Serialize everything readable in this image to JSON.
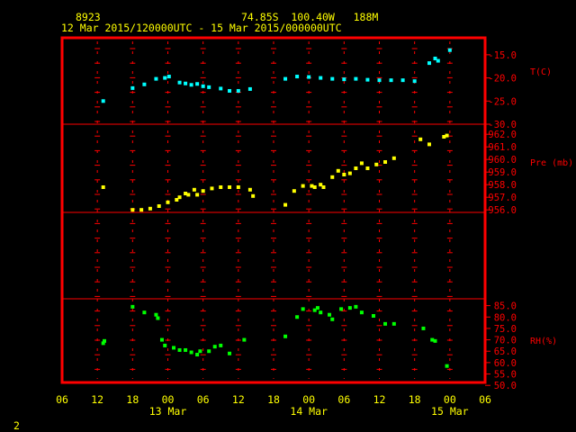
{
  "header": {
    "station": "8923",
    "location": "74.85S  100.40W   188M",
    "time_range": "12 Mar 2015/120000UTC - 15 Mar 2015/000000UTC"
  },
  "footer": {
    "page_number": "2"
  },
  "colors": {
    "frame": "#ff0000",
    "text": "#ffff00",
    "axis_text": "#ff0000",
    "temperature": "#00ffff",
    "pressure": "#ffff00",
    "humidity": "#00ff00"
  },
  "chart_data": {
    "type": "scatter",
    "x_axis": {
      "unit": "hours since 12 Mar 2015 00UTC",
      "range": [
        6,
        78
      ],
      "ticks": [
        {
          "x": 6,
          "label": "06"
        },
        {
          "x": 12,
          "label": "12"
        },
        {
          "x": 18,
          "label": "18"
        },
        {
          "x": 24,
          "label": "00"
        },
        {
          "x": 30,
          "label": "06"
        },
        {
          "x": 36,
          "label": "12"
        },
        {
          "x": 42,
          "label": "18"
        },
        {
          "x": 48,
          "label": "00"
        },
        {
          "x": 54,
          "label": "06"
        },
        {
          "x": 60,
          "label": "12"
        },
        {
          "x": 66,
          "label": "18"
        },
        {
          "x": 72,
          "label": "00"
        },
        {
          "x": 78,
          "label": "06"
        }
      ],
      "date_labels": [
        {
          "x": 24,
          "label": "13 Mar"
        },
        {
          "x": 48,
          "label": "14 Mar"
        },
        {
          "x": 72,
          "label": "15 Mar"
        }
      ]
    },
    "panels": [
      {
        "name": "temperature",
        "label": "T(C)",
        "ylim": [
          -30,
          -12.5
        ],
        "ticks": [
          {
            "v": -15,
            "label": "-15.0"
          },
          {
            "v": -20,
            "label": "-20.0"
          },
          {
            "v": -25,
            "label": "-25.0"
          },
          {
            "v": -30,
            "label": "-30.0"
          }
        ],
        "points": [
          [
            13,
            -25.0
          ],
          [
            18,
            -22.2
          ],
          [
            20,
            -21.4
          ],
          [
            22,
            -20.2
          ],
          [
            23.5,
            -20.0
          ],
          [
            24.2,
            -19.7
          ],
          [
            26,
            -21.0
          ],
          [
            27,
            -21.2
          ],
          [
            28,
            -21.5
          ],
          [
            29,
            -21.3
          ],
          [
            30,
            -21.8
          ],
          [
            31,
            -22.0
          ],
          [
            33,
            -22.3
          ],
          [
            34.5,
            -22.8
          ],
          [
            36,
            -22.8
          ],
          [
            38,
            -22.4
          ],
          [
            44,
            -20.2
          ],
          [
            46,
            -19.7
          ],
          [
            48,
            -19.8
          ],
          [
            50,
            -20.0
          ],
          [
            52,
            -20.2
          ],
          [
            54,
            -20.3
          ],
          [
            56,
            -20.2
          ],
          [
            58,
            -20.4
          ],
          [
            60,
            -20.5
          ],
          [
            62,
            -20.5
          ],
          [
            64,
            -20.5
          ],
          [
            66,
            -20.7
          ],
          [
            68.5,
            -16.8
          ],
          [
            69.5,
            -15.8
          ],
          [
            70,
            -16.3
          ],
          [
            72,
            -14.0
          ]
        ]
      },
      {
        "name": "pressure",
        "label": "Pre (mb)",
        "ylim": [
          955.8,
          962.8
        ],
        "ticks": [
          {
            "v": 956,
            "label": "956.0"
          },
          {
            "v": 957,
            "label": "957.0"
          },
          {
            "v": 958,
            "label": "958.0"
          },
          {
            "v": 959,
            "label": "959.0"
          },
          {
            "v": 960,
            "label": "960.0"
          },
          {
            "v": 961,
            "label": "961.0"
          },
          {
            "v": 962,
            "label": "962.0"
          }
        ],
        "points": [
          [
            13,
            957.8
          ],
          [
            18,
            956.0
          ],
          [
            19.5,
            956.0
          ],
          [
            21,
            956.1
          ],
          [
            22.5,
            956.3
          ],
          [
            24,
            956.6
          ],
          [
            25.5,
            956.8
          ],
          [
            26,
            957.0
          ],
          [
            27,
            957.3
          ],
          [
            27.5,
            957.2
          ],
          [
            28.5,
            957.6
          ],
          [
            29,
            957.2
          ],
          [
            30,
            957.5
          ],
          [
            31.5,
            957.7
          ],
          [
            33,
            957.8
          ],
          [
            34.5,
            957.8
          ],
          [
            36,
            957.8
          ],
          [
            38,
            957.6
          ],
          [
            38.5,
            957.1
          ],
          [
            44,
            956.4
          ],
          [
            45.5,
            957.5
          ],
          [
            47,
            957.9
          ],
          [
            48.5,
            957.9
          ],
          [
            49,
            957.8
          ],
          [
            50,
            958.0
          ],
          [
            50.5,
            957.8
          ],
          [
            52,
            958.6
          ],
          [
            53,
            959.1
          ],
          [
            54,
            958.8
          ],
          [
            55,
            958.9
          ],
          [
            56,
            959.3
          ],
          [
            57,
            959.7
          ],
          [
            58,
            959.3
          ],
          [
            59.5,
            959.6
          ],
          [
            61,
            959.8
          ],
          [
            62.5,
            960.1
          ],
          [
            67,
            961.6
          ],
          [
            68.5,
            961.2
          ],
          [
            71,
            961.8
          ],
          [
            71.5,
            961.9
          ]
        ]
      },
      {
        "name": "humidity",
        "label": "RH(%)",
        "ylim": [
          48.5,
          88
        ],
        "ticks": [
          {
            "v": 50,
            "label": "50.0"
          },
          {
            "v": 55,
            "label": "55.0"
          },
          {
            "v": 60,
            "label": "60.0"
          },
          {
            "v": 65,
            "label": "65.0"
          },
          {
            "v": 70,
            "label": "70.0"
          },
          {
            "v": 75,
            "label": "75.0"
          },
          {
            "v": 80,
            "label": "80.0"
          },
          {
            "v": 85,
            "label": "85.0"
          }
        ],
        "points": [
          [
            13,
            68.5
          ],
          [
            13.2,
            69.5
          ],
          [
            18,
            84.5
          ],
          [
            20,
            82.0
          ],
          [
            22,
            81.0
          ],
          [
            22.3,
            79.5
          ],
          [
            23,
            70.0
          ],
          [
            23.5,
            67.5
          ],
          [
            25,
            66.5
          ],
          [
            26,
            65.5
          ],
          [
            27,
            65.5
          ],
          [
            28,
            64.5
          ],
          [
            29,
            63.5
          ],
          [
            29.5,
            65.0
          ],
          [
            31,
            65.0
          ],
          [
            32,
            67.0
          ],
          [
            33,
            67.5
          ],
          [
            34.5,
            64.0
          ],
          [
            37,
            70.0
          ],
          [
            44,
            71.5
          ],
          [
            46,
            80.0
          ],
          [
            47,
            83.5
          ],
          [
            49,
            83.0
          ],
          [
            49.5,
            84.0
          ],
          [
            50,
            82.0
          ],
          [
            51.5,
            81.0
          ],
          [
            52,
            79.0
          ],
          [
            53.5,
            83.5
          ],
          [
            55,
            84.0
          ],
          [
            56,
            84.5
          ],
          [
            57,
            82.0
          ],
          [
            59,
            80.5
          ],
          [
            61,
            77.0
          ],
          [
            62.5,
            77.0
          ],
          [
            67.5,
            75.0
          ],
          [
            69,
            70.0
          ],
          [
            69.5,
            69.5
          ],
          [
            71.5,
            58.5
          ]
        ]
      }
    ]
  }
}
